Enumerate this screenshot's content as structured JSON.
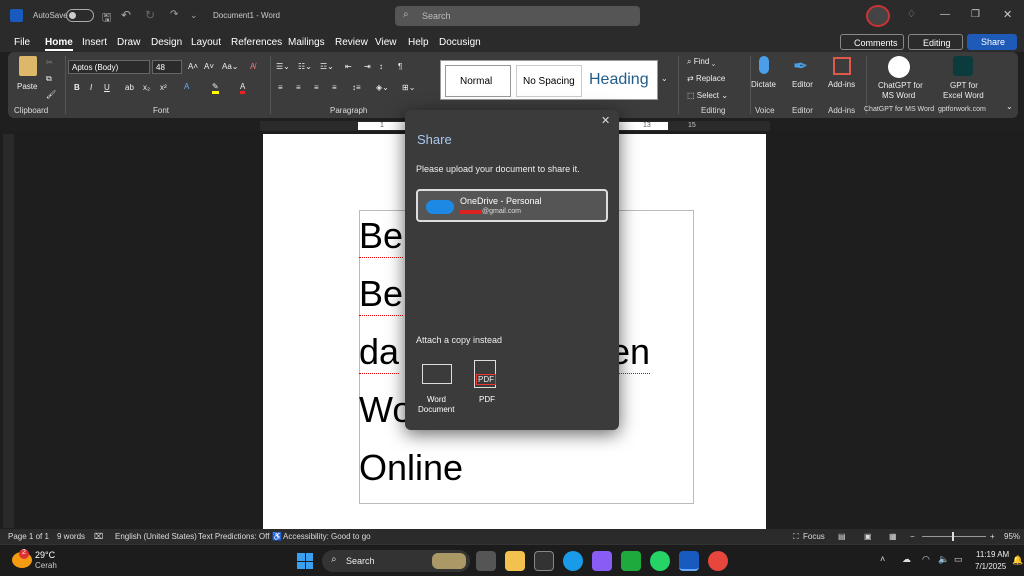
{
  "titlebar": {
    "autosave": "AutoSave",
    "doc_title": "Document1  -  Word",
    "search_placeholder": "Search"
  },
  "tabs": [
    "File",
    "Home",
    "Insert",
    "Draw",
    "Design",
    "Layout",
    "References",
    "Mailings",
    "Review",
    "View",
    "Help",
    "Docusign"
  ],
  "actions": {
    "comments": "Comments",
    "editing": "Editing",
    "share": "Share"
  },
  "ribbon": {
    "clipboard": {
      "paste": "Paste",
      "label": "Clipboard"
    },
    "font": {
      "family": "Aptos (Body)",
      "size": "48",
      "label": "Font"
    },
    "paragraph": {
      "label": "Paragraph"
    },
    "styles": [
      "Normal",
      "No Spacing",
      "Heading"
    ],
    "editing": {
      "find": "Find",
      "replace": "Replace",
      "select": "Select",
      "label": "Editing"
    },
    "voice": {
      "dictate": "Dictate",
      "label": "Voice"
    },
    "editor": {
      "btn": "Editor",
      "label": "Editor"
    },
    "addins": {
      "btn": "Add-ins",
      "label": "Add-ins"
    },
    "chatgpt": {
      "btn1": "ChatGPT for",
      "btn2": "MS Word",
      "label": "ChatGPT for MS Word"
    },
    "gptexcel": {
      "btn1": "GPT for",
      "btn2": "Excel Word",
      "label": "gptforwork.com"
    }
  },
  "ruler": {
    "left": "1",
    "mid": "13",
    "right": "15"
  },
  "document": {
    "lines": [
      "Be",
      "Be",
      "da",
      "Wo",
      "Online"
    ],
    "line_tails": [
      "",
      "",
      "en",
      "",
      ""
    ]
  },
  "share_dialog": {
    "title": "Share",
    "prompt": "Please upload your document to share it.",
    "account_name": "OneDrive - Personal",
    "account_email": "@gmail.com",
    "attach_label": "Attach a copy instead",
    "opt1a": "Word",
    "opt1b": "Document",
    "opt2": "PDF",
    "pdf_badge": "PDF"
  },
  "status": {
    "page": "Page 1 of 1",
    "words": "9 words",
    "lang": "English (United States)",
    "predictions": "Text Predictions: Off",
    "access": "Accessibility: Good to go",
    "focus": "Focus",
    "zoom": "95%"
  },
  "taskbar": {
    "temp": "29°C",
    "weather": "Cerah",
    "badge": "2",
    "search": "Search",
    "time": "11:19 AM",
    "date": "7/1/2025"
  }
}
